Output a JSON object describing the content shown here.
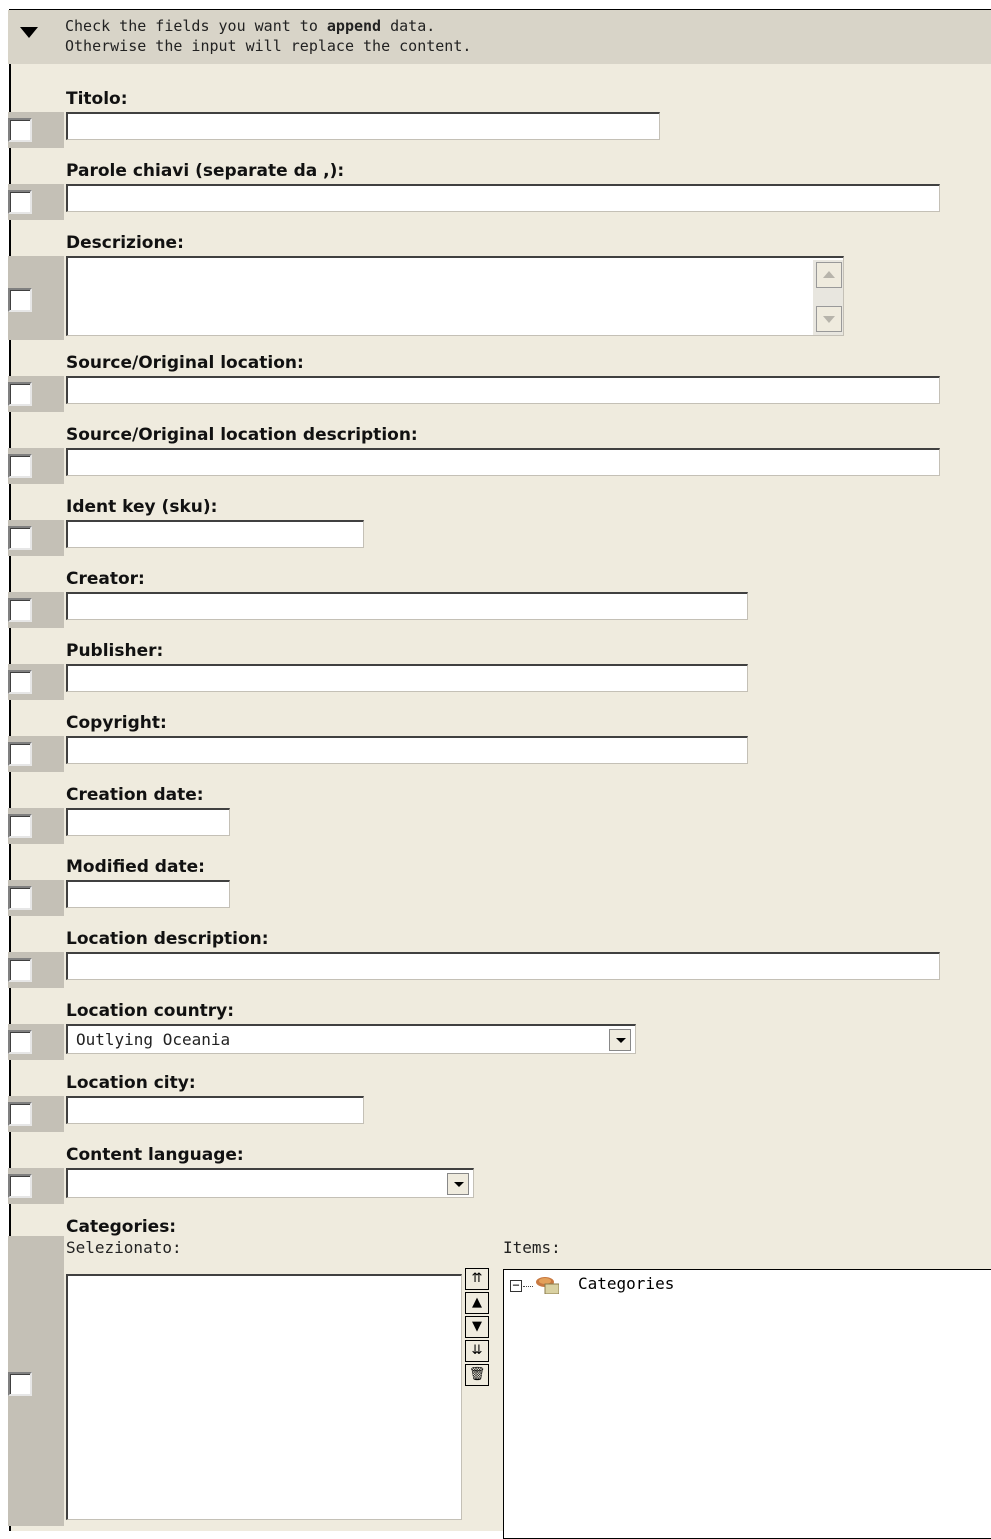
{
  "header": {
    "line1_prefix": "Check the fields you want to",
    "line1_bold": "append",
    "line1_suffix": "data.",
    "line2": "Otherwise the input will replace the content."
  },
  "fields": {
    "titolo": {
      "label": "Titolo:",
      "value": ""
    },
    "parole_chiavi": {
      "label": "Parole chiavi (separate da ,):",
      "value": ""
    },
    "descrizione": {
      "label": "Descrizione:",
      "value": ""
    },
    "source_location": {
      "label": "Source/Original location:",
      "value": ""
    },
    "source_location_desc": {
      "label": "Source/Original location description:",
      "value": ""
    },
    "ident_key": {
      "label": "Ident key (sku):",
      "value": ""
    },
    "creator": {
      "label": "Creator:",
      "value": ""
    },
    "publisher": {
      "label": "Publisher:",
      "value": ""
    },
    "copyright": {
      "label": "Copyright:",
      "value": ""
    },
    "creation_date": {
      "label": "Creation date:",
      "value": ""
    },
    "modified_date": {
      "label": "Modified date:",
      "value": ""
    },
    "location_description": {
      "label": "Location description:",
      "value": ""
    },
    "location_country": {
      "label": "Location country:",
      "selected": "Outlying Oceania"
    },
    "location_city": {
      "label": "Location city:",
      "value": ""
    },
    "content_language": {
      "label": "Content language:",
      "selected": ""
    },
    "categories": {
      "label": "Categories:",
      "selected_label": "Selezionato:",
      "items_label": "Items:",
      "tree_root": "Categories",
      "tree_toggle": "−"
    }
  },
  "icons": {
    "header_toggle": "chevron-down-icon",
    "tree_folder": "folder-icon",
    "move_top": "⇈",
    "move_up": "▲",
    "move_down": "▼",
    "move_bottom": "⇊",
    "delete": "🗑"
  }
}
